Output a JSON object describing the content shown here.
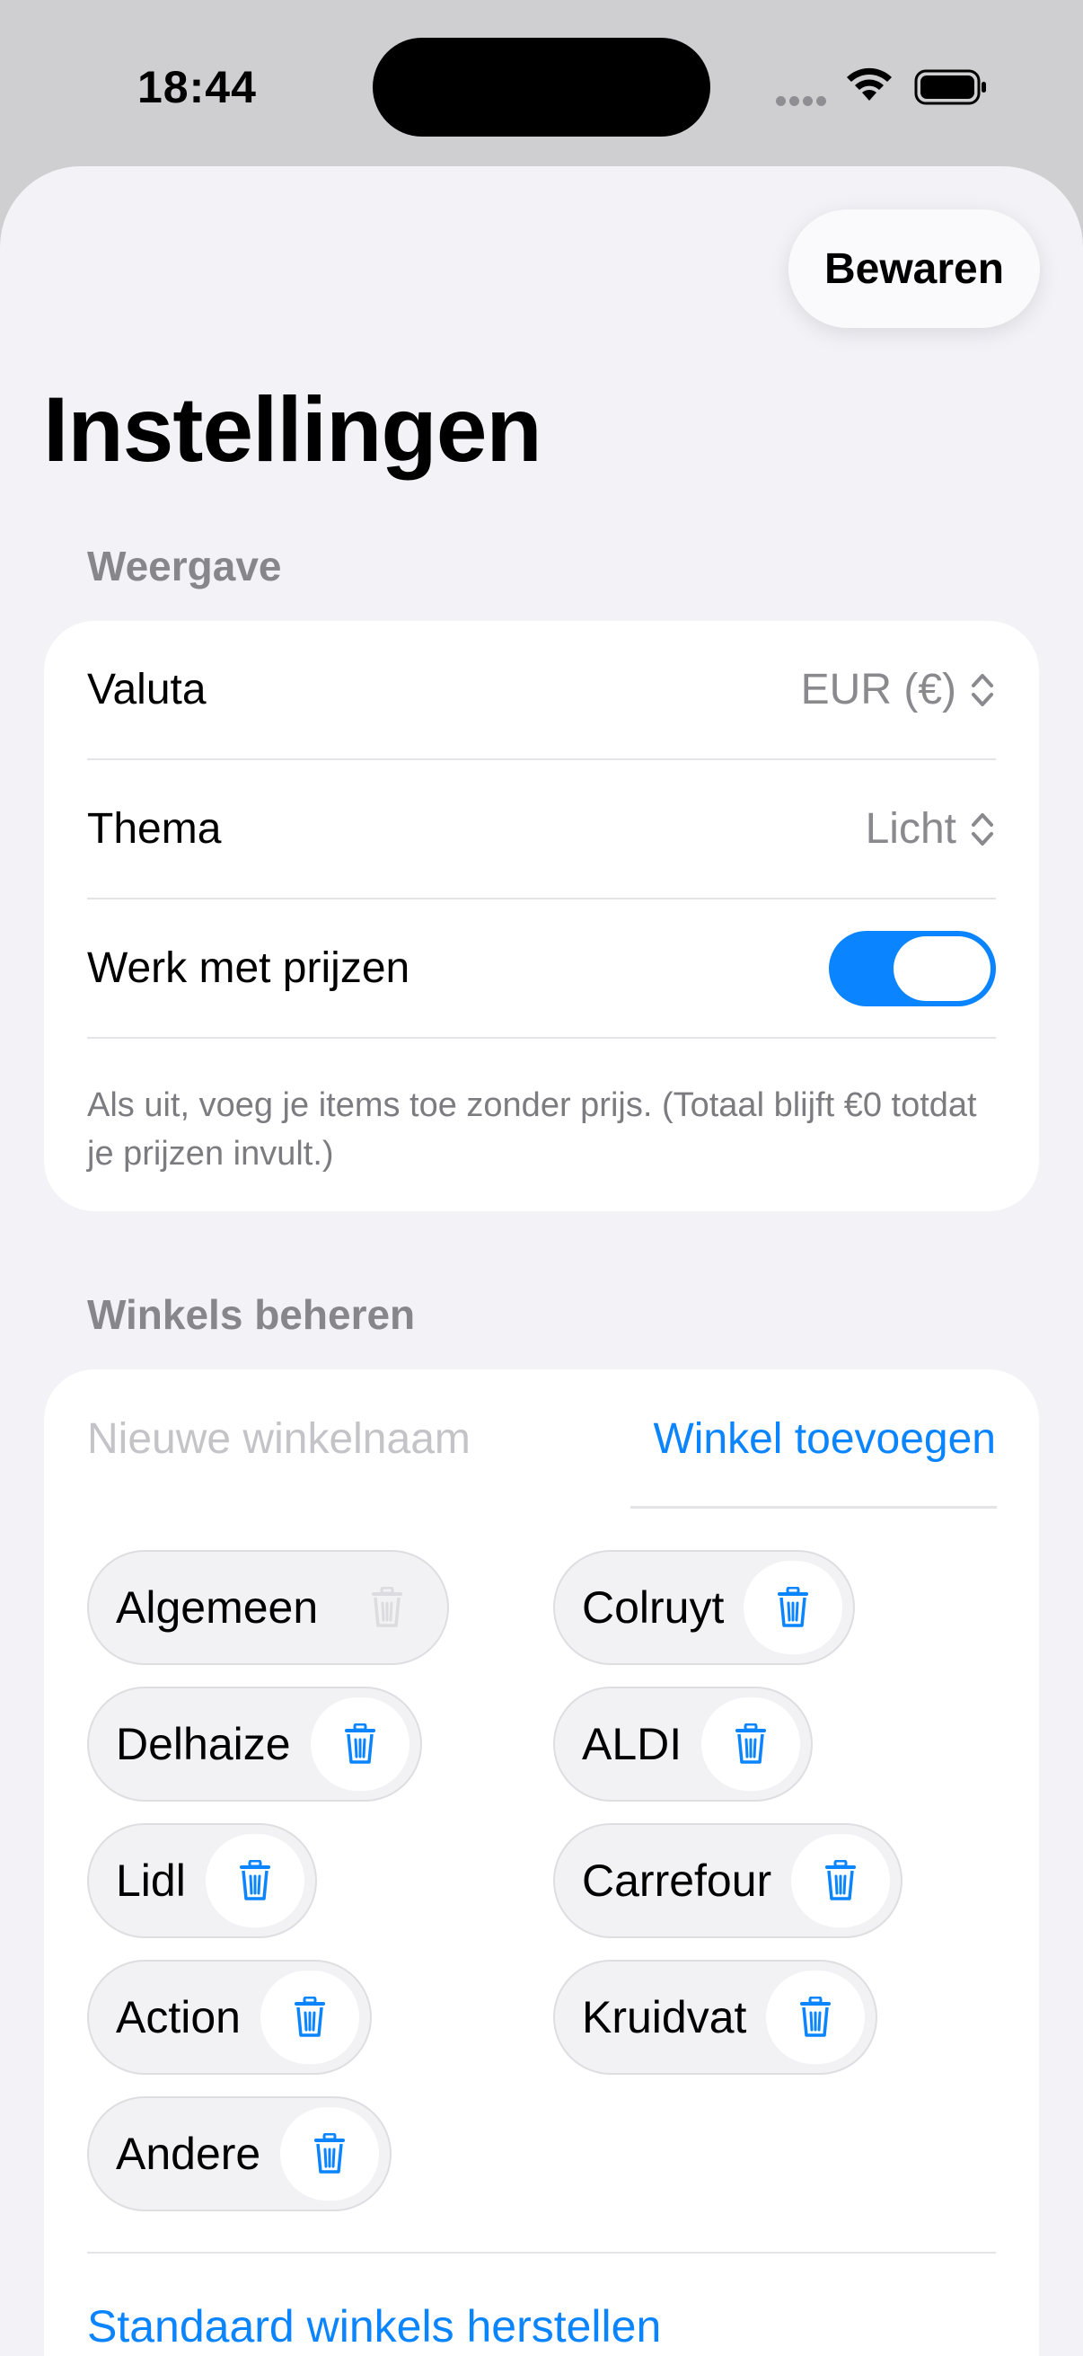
{
  "status_bar": {
    "time": "18:44"
  },
  "toolbar": {
    "save_label": "Bewaren"
  },
  "page": {
    "title": "Instellingen"
  },
  "display_section": {
    "header": "Weergave",
    "currency": {
      "label": "Valuta",
      "value": "EUR (€)"
    },
    "theme": {
      "label": "Thema",
      "value": "Licht"
    },
    "prices": {
      "label": "Werk met prijzen",
      "enabled": true
    },
    "footnote": "Als uit, voeg je items toe zonder prijs. (Totaal blijft €0 totdat je prijzen invult.)"
  },
  "stores_section": {
    "header": "Winkels beheren",
    "new_store_placeholder": "Nieuwe winkelnaam",
    "new_store_value": "",
    "add_label": "Winkel toevoegen",
    "stores": [
      {
        "name": "Algemeen",
        "deletable": false
      },
      {
        "name": "Colruyt",
        "deletable": true
      },
      {
        "name": "Delhaize",
        "deletable": true
      },
      {
        "name": "ALDI",
        "deletable": true
      },
      {
        "name": "Lidl",
        "deletable": true
      },
      {
        "name": "Carrefour",
        "deletable": true
      },
      {
        "name": "Action",
        "deletable": true
      },
      {
        "name": "Kruidvat",
        "deletable": true
      },
      {
        "name": "Andere",
        "deletable": true
      }
    ],
    "restore_label": "Standaard winkels herstellen"
  },
  "colors": {
    "accent": "#0a84ff",
    "background": "#f2f2f7",
    "secondary_text": "#86868b"
  },
  "icons": {
    "trash": "trash-icon",
    "chevron": "chevron-updown-icon"
  }
}
